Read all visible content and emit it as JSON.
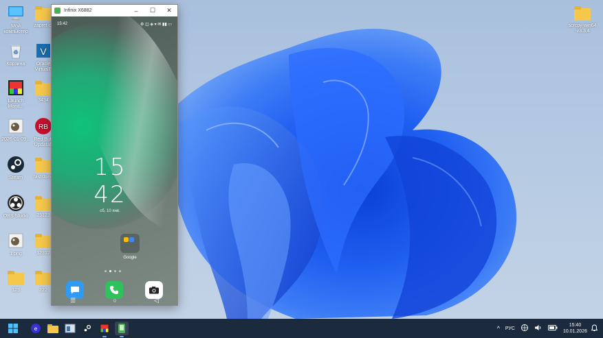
{
  "desktop": {
    "icons_col1": [
      {
        "label": "Мой\nкомпьютер",
        "icon": "computer-icon"
      },
      {
        "label": "Корзина",
        "icon": "recycle-bin-icon"
      },
      {
        "label": "Launch\nMonit...",
        "icon": "launch-monitor-icon"
      },
      {
        "label": "2026-01-09...",
        "icon": "gimp-image-icon"
      },
      {
        "label": "Steam",
        "icon": "steam-icon"
      },
      {
        "label": "OBS Studio",
        "icon": "obs-icon"
      },
      {
        "label": "1.png",
        "icon": "gimp-png-icon"
      },
      {
        "label": "123",
        "icon": "folder-icon"
      }
    ],
    "icons_col2": [
      {
        "label": "zapret-di",
        "icon": "folder-icon"
      },
      {
        "label": "Oracle\nVirtualB",
        "icon": "virtualbox-icon"
      },
      {
        "label": "3434",
        "icon": "folder-icon"
      },
      {
        "label": "Red Butt\nUpdatab",
        "icon": "red-button-icon"
      },
      {
        "label": "faststone",
        "icon": "folder-icon"
      },
      {
        "label": "23123",
        "icon": "folder-icon"
      },
      {
        "label": "12312",
        "icon": "folder-icon"
      },
      {
        "label": "222",
        "icon": "folder-icon"
      }
    ],
    "icon_right": {
      "label": "scrcpy-win64\n-v3.3.4",
      "icon": "folder-icon"
    }
  },
  "phone_window": {
    "title": "Infinix X6882",
    "minimize": "–",
    "maximize": "☐",
    "close": "✕",
    "status_time": "15:42",
    "status_icons": "⚙ ◫ ◈ ▾ ✉ ▮▮ ▭",
    "clock_hour": "15",
    "clock_minute": "42",
    "date": "сб, 10 янв.",
    "folder_label": "Google",
    "nav": {
      "menu": "☰",
      "home": "○",
      "back": "◁"
    }
  },
  "taskbar": {
    "lang": "РУС",
    "time": "15:40",
    "date": "10.01.2026",
    "chevron": "^"
  },
  "colors": {
    "taskbar": "#1b2a3d",
    "accent": "#0078d4"
  }
}
